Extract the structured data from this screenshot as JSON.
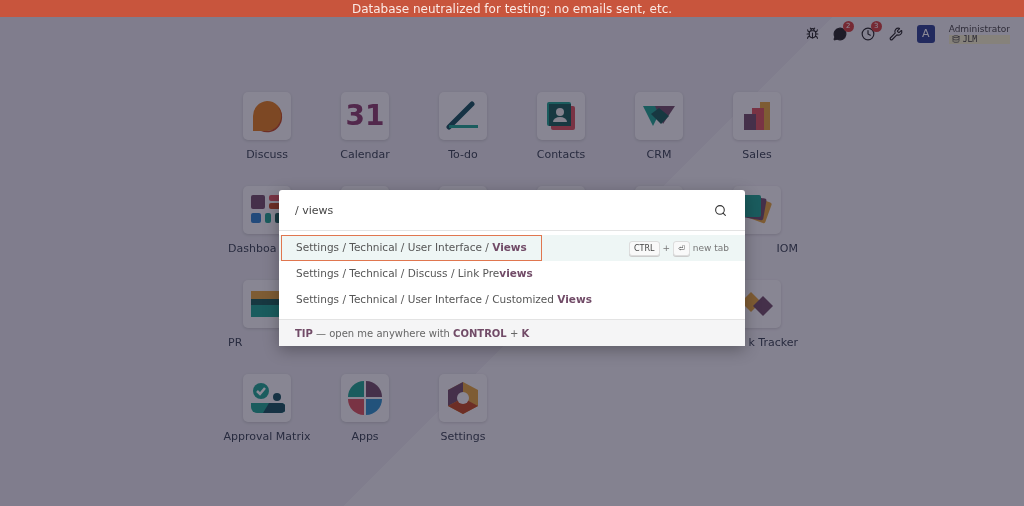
{
  "banner": "Database neutralized for testing: no emails sent, etc.",
  "topbar": {
    "chat_count": "2",
    "activity_count": "3",
    "avatar": "A",
    "user": "Administrator",
    "database": "JLM"
  },
  "apps": [
    {
      "kind": "discuss",
      "label": "Discuss"
    },
    {
      "kind": "calendar",
      "label": "Calendar",
      "icon_text": "31"
    },
    {
      "kind": "todo",
      "label": "To-do"
    },
    {
      "kind": "contacts",
      "label": "Contacts"
    },
    {
      "kind": "crm",
      "label": "CRM"
    },
    {
      "kind": "sales",
      "label": "Sales"
    },
    {
      "kind": "dashboard",
      "label": "Dashboa"
    },
    {
      "kind": "covered"
    },
    {
      "kind": "covered"
    },
    {
      "kind": "covered"
    },
    {
      "kind": "covered"
    },
    {
      "kind": "iom",
      "label": "IOM"
    },
    {
      "kind": "pr",
      "label": "PR"
    },
    {
      "kind": "covered"
    },
    {
      "kind": "covered"
    },
    {
      "kind": "covered"
    },
    {
      "kind": "covered"
    },
    {
      "kind": "tracker",
      "label": "k Tracker"
    },
    {
      "kind": "approval",
      "label": "Approval Matrix"
    },
    {
      "kind": "apps",
      "label": "Apps"
    },
    {
      "kind": "settings",
      "label": "Settings"
    }
  ],
  "palette": {
    "query": "/ views",
    "results": [
      {
        "text": "Settings / Technical / User Interface / **Views**",
        "selected": true
      },
      {
        "text": "Settings / Technical / Discuss / Link Pre**views**",
        "selected": false
      },
      {
        "text": "Settings / Technical / User Interface / Customized **Views**",
        "selected": false
      }
    ],
    "shortcut": {
      "key1": "CTRL",
      "plus": "+",
      "key2": "⏎",
      "hint": "new tab"
    },
    "tip": "**TIP** — open me anywhere with **CONTROL** + **K**"
  }
}
